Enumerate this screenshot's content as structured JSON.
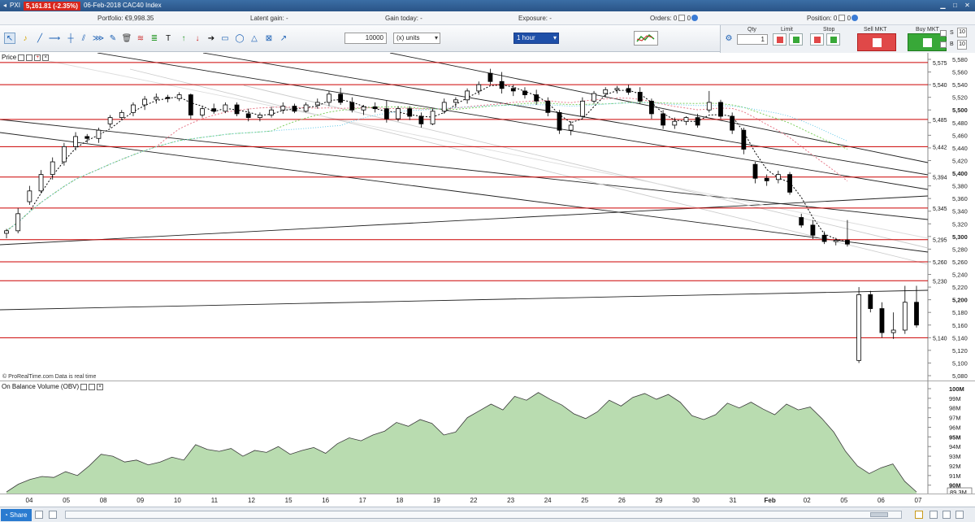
{
  "titlebar": {
    "app": "PXI",
    "price": "5,161.81 (-2.35%)",
    "date_instrument": "06-Feb-2018 CAC40 Index"
  },
  "infobar": {
    "portfolio": "Portfolio: €9,998.35",
    "latent_gain": "Latent gain: -",
    "gain_today": "Gain today: -",
    "exposure": "Exposure: -",
    "orders": "Orders: 0",
    "orders_zero": "0",
    "position": "Position: 0",
    "position_zero": "0"
  },
  "toolbar": {
    "quantity": "10000",
    "units": "(x) units",
    "timeframe": "1 hour"
  },
  "order_panel": {
    "qty_label": "Qty",
    "qty_value": "1",
    "limit_label": "Limit",
    "stop_label": "Stop",
    "sell_label": "Sell MKT",
    "buy_label": "Buy MKT",
    "s_label": "S",
    "b_label": "B",
    "s_value": "10",
    "b_value": "10"
  },
  "price_panel": {
    "title": "Price",
    "copyright": "© ProRealTime.com  Data is real time"
  },
  "obv_panel": {
    "title": "On Balance Volume (OBV)"
  },
  "colors": {
    "up_candle": "#ffffff",
    "down_candle": "#000000",
    "resistance": "#cc0000",
    "obv_fill": "#b9dcb0",
    "obv_line": "#3a3a3a",
    "ma_short": "#000000",
    "ma_pink": "#e87a8a",
    "ma_green": "#7fcf5f",
    "ma_cyan": "#5fc8e8",
    "accent": "#1e4fa8"
  },
  "chart_data": [
    {
      "type": "candlestick",
      "title": "Price",
      "ylim": [
        5080,
        5580
      ],
      "y_ticks": [
        5080,
        5100,
        5120,
        5140,
        5160,
        5180,
        5200,
        5220,
        5240,
        5260,
        5280,
        5300,
        5320,
        5340,
        5360,
        5380,
        5400,
        5420,
        5440,
        5460,
        5480,
        5500,
        5520,
        5540,
        5560,
        5580
      ],
      "y_tick_labels": [
        "5,080",
        "5,100",
        "5,120",
        "5,140",
        "5,160",
        "5,180",
        "5,200",
        "5,220",
        "5,240",
        "5,260",
        "5,280",
        "5,300",
        "5,320",
        "5,340",
        "5,360",
        "5,380",
        "5,400",
        "5,420",
        "5,440",
        "5,460",
        "5,480",
        "5,500",
        "5,520",
        "5,540",
        "5,560",
        "5,580"
      ],
      "bold_tick_labels": [
        "5,200",
        "5,300",
        "5,400",
        "5,500"
      ],
      "resistance_levels": [
        5575,
        5540,
        5485,
        5442,
        5394,
        5345,
        5295,
        5260,
        5230,
        5140
      ],
      "resistance_labels": [
        "5,575",
        "5,540",
        "5,485",
        "5,442",
        "5,394",
        "5,345",
        "5,295",
        "5,260",
        "5,230",
        "5,140"
      ],
      "x_labels": [
        "04",
        "05",
        "08",
        "09",
        "10",
        "11",
        "12",
        "15",
        "16",
        "17",
        "18",
        "19",
        "22",
        "23",
        "24",
        "25",
        "26",
        "29",
        "30",
        "31",
        "Feb",
        "02",
        "05",
        "06",
        "07"
      ],
      "x_label_bold": "Feb",
      "candles": [
        {
          "o": 5305,
          "h": 5312,
          "l": 5297,
          "c": 5309
        },
        {
          "o": 5309,
          "h": 5345,
          "l": 5305,
          "c": 5336
        },
        {
          "o": 5355,
          "h": 5380,
          "l": 5350,
          "c": 5372
        },
        {
          "o": 5372,
          "h": 5405,
          "l": 5368,
          "c": 5398
        },
        {
          "o": 5398,
          "h": 5425,
          "l": 5390,
          "c": 5418
        },
        {
          "o": 5418,
          "h": 5448,
          "l": 5412,
          "c": 5442
        },
        {
          "o": 5442,
          "h": 5465,
          "l": 5436,
          "c": 5458
        },
        {
          "o": 5458,
          "h": 5462,
          "l": 5448,
          "c": 5455
        },
        {
          "o": 5455,
          "h": 5472,
          "l": 5448,
          "c": 5468
        },
        {
          "o": 5478,
          "h": 5492,
          "l": 5472,
          "c": 5488
        },
        {
          "o": 5488,
          "h": 5500,
          "l": 5484,
          "c": 5496
        },
        {
          "o": 5496,
          "h": 5512,
          "l": 5490,
          "c": 5508
        },
        {
          "o": 5508,
          "h": 5522,
          "l": 5500,
          "c": 5517
        },
        {
          "o": 5517,
          "h": 5526,
          "l": 5510,
          "c": 5520
        },
        {
          "o": 5520,
          "h": 5524,
          "l": 5512,
          "c": 5518
        },
        {
          "o": 5518,
          "h": 5528,
          "l": 5514,
          "c": 5524
        },
        {
          "o": 5524,
          "h": 5526,
          "l": 5486,
          "c": 5492
        },
        {
          "o": 5492,
          "h": 5505,
          "l": 5488,
          "c": 5502
        },
        {
          "o": 5502,
          "h": 5510,
          "l": 5494,
          "c": 5498
        },
        {
          "o": 5498,
          "h": 5512,
          "l": 5495,
          "c": 5508
        },
        {
          "o": 5508,
          "h": 5512,
          "l": 5490,
          "c": 5494
        },
        {
          "o": 5494,
          "h": 5502,
          "l": 5482,
          "c": 5488
        },
        {
          "o": 5488,
          "h": 5496,
          "l": 5482,
          "c": 5492
        },
        {
          "o": 5492,
          "h": 5505,
          "l": 5488,
          "c": 5500
        },
        {
          "o": 5500,
          "h": 5512,
          "l": 5494,
          "c": 5506
        },
        {
          "o": 5506,
          "h": 5510,
          "l": 5495,
          "c": 5498
        },
        {
          "o": 5498,
          "h": 5512,
          "l": 5496,
          "c": 5508
        },
        {
          "o": 5508,
          "h": 5518,
          "l": 5502,
          "c": 5512
        },
        {
          "o": 5512,
          "h": 5530,
          "l": 5506,
          "c": 5525
        },
        {
          "o": 5525,
          "h": 5535,
          "l": 5508,
          "c": 5512
        },
        {
          "o": 5512,
          "h": 5520,
          "l": 5496,
          "c": 5500
        },
        {
          "o": 5500,
          "h": 5508,
          "l": 5492,
          "c": 5505
        },
        {
          "o": 5505,
          "h": 5512,
          "l": 5496,
          "c": 5502
        },
        {
          "o": 5502,
          "h": 5515,
          "l": 5480,
          "c": 5486
        },
        {
          "o": 5486,
          "h": 5506,
          "l": 5482,
          "c": 5502
        },
        {
          "o": 5502,
          "h": 5506,
          "l": 5484,
          "c": 5490
        },
        {
          "o": 5490,
          "h": 5496,
          "l": 5472,
          "c": 5478
        },
        {
          "o": 5478,
          "h": 5502,
          "l": 5476,
          "c": 5498
        },
        {
          "o": 5498,
          "h": 5518,
          "l": 5494,
          "c": 5512
        },
        {
          "o": 5512,
          "h": 5520,
          "l": 5504,
          "c": 5516
        },
        {
          "o": 5516,
          "h": 5534,
          "l": 5510,
          "c": 5530
        },
        {
          "o": 5530,
          "h": 5545,
          "l": 5524,
          "c": 5540
        },
        {
          "o": 5558,
          "h": 5565,
          "l": 5540,
          "c": 5545
        },
        {
          "o": 5545,
          "h": 5560,
          "l": 5526,
          "c": 5534
        },
        {
          "o": 5534,
          "h": 5540,
          "l": 5522,
          "c": 5530
        },
        {
          "o": 5530,
          "h": 5536,
          "l": 5518,
          "c": 5524
        },
        {
          "o": 5524,
          "h": 5532,
          "l": 5508,
          "c": 5514
        },
        {
          "o": 5514,
          "h": 5520,
          "l": 5490,
          "c": 5496
        },
        {
          "o": 5496,
          "h": 5500,
          "l": 5462,
          "c": 5468
        },
        {
          "o": 5468,
          "h": 5482,
          "l": 5460,
          "c": 5476
        },
        {
          "o": 5490,
          "h": 5520,
          "l": 5486,
          "c": 5514
        },
        {
          "o": 5514,
          "h": 5530,
          "l": 5510,
          "c": 5526
        },
        {
          "o": 5526,
          "h": 5536,
          "l": 5520,
          "c": 5532
        },
        {
          "o": 5532,
          "h": 5538,
          "l": 5526,
          "c": 5534
        },
        {
          "o": 5534,
          "h": 5540,
          "l": 5524,
          "c": 5528
        },
        {
          "o": 5528,
          "h": 5536,
          "l": 5510,
          "c": 5514
        },
        {
          "o": 5514,
          "h": 5518,
          "l": 5486,
          "c": 5494
        },
        {
          "o": 5494,
          "h": 5500,
          "l": 5470,
          "c": 5476
        },
        {
          "o": 5476,
          "h": 5488,
          "l": 5470,
          "c": 5482
        },
        {
          "o": 5482,
          "h": 5490,
          "l": 5476,
          "c": 5488
        },
        {
          "o": 5488,
          "h": 5494,
          "l": 5472,
          "c": 5476
        },
        {
          "o": 5500,
          "h": 5530,
          "l": 5496,
          "c": 5512
        },
        {
          "o": 5512,
          "h": 5516,
          "l": 5486,
          "c": 5490
        },
        {
          "o": 5490,
          "h": 5496,
          "l": 5462,
          "c": 5468
        },
        {
          "o": 5468,
          "h": 5472,
          "l": 5430,
          "c": 5438
        },
        {
          "o": 5414,
          "h": 5418,
          "l": 5384,
          "c": 5392
        },
        {
          "o": 5392,
          "h": 5398,
          "l": 5380,
          "c": 5388
        },
        {
          "o": 5390,
          "h": 5404,
          "l": 5384,
          "c": 5398
        },
        {
          "o": 5398,
          "h": 5402,
          "l": 5366,
          "c": 5370
        },
        {
          "o": 5330,
          "h": 5336,
          "l": 5314,
          "c": 5318
        },
        {
          "o": 5318,
          "h": 5326,
          "l": 5296,
          "c": 5302
        },
        {
          "o": 5302,
          "h": 5308,
          "l": 5288,
          "c": 5292
        },
        {
          "o": 5292,
          "h": 5298,
          "l": 5286,
          "c": 5294
        },
        {
          "o": 5294,
          "h": 5326,
          "l": 5284,
          "c": 5288
        },
        {
          "o": 5104,
          "h": 5220,
          "l": 5100,
          "c": 5208
        },
        {
          "o": 5208,
          "h": 5214,
          "l": 5180,
          "c": 5186
        },
        {
          "o": 5186,
          "h": 5196,
          "l": 5140,
          "c": 5148
        },
        {
          "o": 5148,
          "h": 5180,
          "l": 5138,
          "c": 5152
        },
        {
          "o": 5152,
          "h": 5222,
          "l": 5146,
          "c": 5196
        },
        {
          "o": 5196,
          "h": 5222,
          "l": 5156,
          "c": 5160
        }
      ]
    },
    {
      "type": "area",
      "title": "On Balance Volume (OBV)",
      "ylim": [
        89.3,
        100
      ],
      "y_ticks": [
        90,
        91,
        92,
        93,
        94,
        95,
        96,
        97,
        98,
        99,
        100
      ],
      "y_tick_labels": [
        "90M",
        "91M",
        "92M",
        "93M",
        "94M",
        "95M",
        "96M",
        "97M",
        "98M",
        "99M",
        "100M"
      ],
      "bold_tick_labels": [
        "90M",
        "95M",
        "100M"
      ],
      "last_value_label": "89.3M",
      "values": [
        89.3,
        90.1,
        90.6,
        90.9,
        90.8,
        91.4,
        91.0,
        92.0,
        93.2,
        93.0,
        92.4,
        92.6,
        92.1,
        92.4,
        92.9,
        92.6,
        94.2,
        93.7,
        93.5,
        93.8,
        93.0,
        93.6,
        93.4,
        94.0,
        93.2,
        93.6,
        93.9,
        93.3,
        94.3,
        94.9,
        94.6,
        95.2,
        95.6,
        96.5,
        96.1,
        96.8,
        96.4,
        95.2,
        95.5,
        97.0,
        97.7,
        98.4,
        97.8,
        99.2,
        98.8,
        99.6,
        98.9,
        98.3,
        97.4,
        96.9,
        97.6,
        98.8,
        98.2,
        99.1,
        99.5,
        98.9,
        99.4,
        98.6,
        97.2,
        96.8,
        97.3,
        98.5,
        98.0,
        98.6,
        97.9,
        97.3,
        98.4,
        97.8,
        98.1,
        96.9,
        95.5,
        93.5,
        92.0,
        91.2,
        91.8,
        92.2,
        90.4,
        89.3
      ]
    }
  ]
}
